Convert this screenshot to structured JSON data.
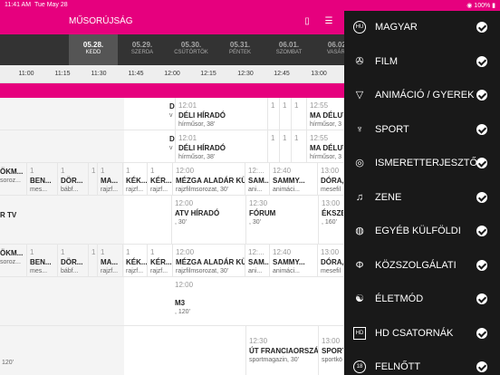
{
  "status": {
    "time": "11:41 AM",
    "date": "Tue May 28",
    "battery": "100%"
  },
  "header": {
    "title": "MŰSORÚJSÁG",
    "remote_icon": "remote-icon",
    "filter_icon": "filter-icon"
  },
  "dates": [
    {
      "date": "05.28.",
      "weekday": "KEDD",
      "selected": true
    },
    {
      "date": "05.29.",
      "weekday": "SZERDA"
    },
    {
      "date": "05.30.",
      "weekday": "CSÜTÖRTÖK"
    },
    {
      "date": "05.31.",
      "weekday": "PÉNTEK"
    },
    {
      "date": "06.01.",
      "weekday": "SZOMBAT"
    },
    {
      "date": "06.02.",
      "weekday": "VASÁRN"
    }
  ],
  "timeline": [
    "11:00",
    "11:15",
    "11:30",
    "11:45",
    "12:00",
    "12:15",
    "12:30",
    "12:45",
    "13:00"
  ],
  "rows": [
    {
      "cells": [
        {
          "time": "12:01",
          "name": "DÉLI HÍRADÓ",
          "sub": "hírműsor, 38'"
        },
        {
          "time": "1",
          "name": "",
          "sub": ""
        },
        {
          "time": "1",
          "name": "",
          "sub": ""
        },
        {
          "time": "1",
          "name": "",
          "sub": ""
        },
        {
          "time": "12:55",
          "name": "MA DÉLUTÁ",
          "sub": "hírműsor, 3"
        },
        {
          "time": "",
          "name": "D",
          "sub": "v"
        }
      ]
    },
    {
      "cells": [
        {
          "time": "12:01",
          "name": "DÉLI HÍRADÓ",
          "sub": "hírműsor, 38'"
        },
        {
          "time": "1",
          "name": "",
          "sub": ""
        },
        {
          "time": "1",
          "name": "",
          "sub": ""
        },
        {
          "time": "1",
          "name": "",
          "sub": ""
        },
        {
          "time": "12:55",
          "name": "MA DÉLUTÁ",
          "sub": "hírműsor, 3"
        },
        {
          "time": "",
          "name": "D",
          "sub": "v"
        }
      ]
    },
    {
      "cells": [
        {
          "time": "",
          "name": "ÖKM...",
          "sub": "soroz..."
        },
        {
          "time": "1",
          "name": "BEN...",
          "sub": "mes..."
        },
        {
          "time": "1",
          "name": "DÖR...",
          "sub": "bábf..."
        },
        {
          "time": "1",
          "name": "MA...",
          "sub": "rajzf..."
        },
        {
          "time": "1",
          "name": "KÉK...",
          "sub": "rajzf..."
        },
        {
          "time": "1",
          "name": "KÉR...",
          "sub": "rajzf..."
        },
        {
          "time": "12:00",
          "name": "MÉZGA ALADÁR KÜ...",
          "sub": "rajzfilmsorozat, 30'"
        },
        {
          "time": "12:...",
          "name": "SAM...",
          "sub": "ani..."
        },
        {
          "time": "12:40",
          "name": "SAMMY...",
          "sub": "animáci..."
        },
        {
          "time": "13:00",
          "name": "DÓRA,",
          "sub": "mesefil"
        }
      ]
    },
    {
      "cells": [
        {
          "time": "",
          "name": "R TV",
          "sub": ""
        },
        {
          "time": "12:00",
          "name": "ATV HÍRADÓ",
          "sub": ", 30'"
        },
        {
          "time": "12:30",
          "name": "FÓRUM",
          "sub": ", 30'"
        },
        {
          "time": "13:00",
          "name": "ÉKSZER",
          "sub": ", 160'"
        }
      ]
    },
    {
      "cells": [
        {
          "time": "",
          "name": "ÖKM...",
          "sub": "soroz..."
        },
        {
          "time": "1",
          "name": "BEN...",
          "sub": "mes..."
        },
        {
          "time": "1",
          "name": "DÖR...",
          "sub": "bábf..."
        },
        {
          "time": "1",
          "name": "MA...",
          "sub": "rajzf..."
        },
        {
          "time": "1",
          "name": "KÉK...",
          "sub": "rajzf..."
        },
        {
          "time": "1",
          "name": "KÉR...",
          "sub": "rajzf..."
        },
        {
          "time": "12:00",
          "name": "MÉZGA ALADÁR KÜ...",
          "sub": "rajzfilmsorozat, 30'"
        },
        {
          "time": "12:...",
          "name": "SAM...",
          "sub": "ani..."
        },
        {
          "time": "12:40",
          "name": "SAMMY...",
          "sub": "animáci..."
        },
        {
          "time": "13:00",
          "name": "DÓRA,",
          "sub": "mesefil"
        }
      ]
    },
    {
      "cells": [
        {
          "time": "12:00",
          "name": "M3",
          "sub": ", 120'"
        }
      ]
    },
    {
      "cells": [
        {
          "time": "",
          "name": "",
          "sub": "120'"
        },
        {
          "time": "12:30",
          "name": "ÚT FRANCIAORSZÁ...",
          "sub": "sportmagazin, 30'"
        },
        {
          "time": "13:00",
          "name": "SPORT",
          "sub": "sportkö"
        }
      ]
    }
  ],
  "menu": [
    {
      "label": "MAGYAR",
      "icon": "hu-flag-icon"
    },
    {
      "label": "FILM",
      "icon": "film-reel-icon"
    },
    {
      "label": "ANIMÁCIÓ / GYEREK",
      "icon": "kids-icon"
    },
    {
      "label": "SPORT",
      "icon": "trophy-icon"
    },
    {
      "label": "ISMERETTERJESZTŐ",
      "icon": "compass-icon"
    },
    {
      "label": "ZENE",
      "icon": "music-note-icon"
    },
    {
      "label": "EGYÉB KÜLFÖLDI",
      "icon": "globe-icon"
    },
    {
      "label": "KÖZSZOLGÁLATI",
      "icon": "public-service-icon"
    },
    {
      "label": "ÉLETMÓD",
      "icon": "yin-yang-icon"
    },
    {
      "label": "HD CSATORNÁK",
      "icon": "hd-icon"
    },
    {
      "label": "FELNŐTT",
      "icon": "adult-18-icon"
    }
  ],
  "colors": {
    "accent": "#e6007e",
    "menu_bg": "#1a1a1a",
    "date_bar": "#333333"
  }
}
